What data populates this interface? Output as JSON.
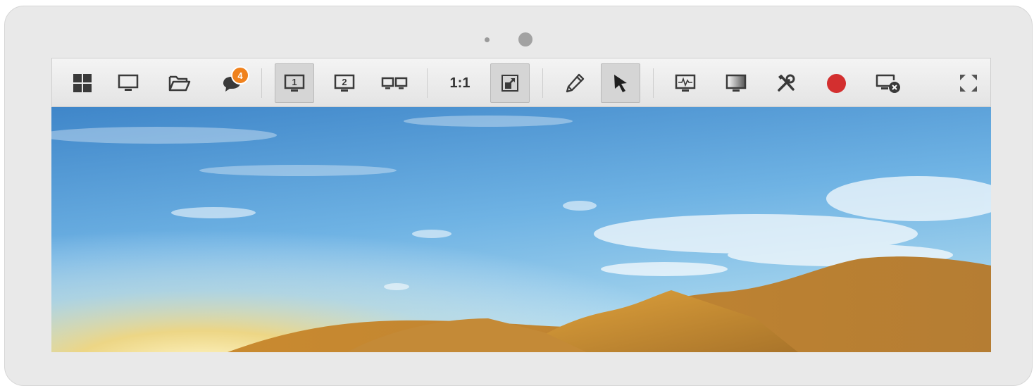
{
  "toolbar": {
    "chat_badge_count": "4",
    "scale_label": "1:1",
    "monitor1_label": "1",
    "monitor2_label": "2",
    "record_color": "#d32f2f",
    "badge_color": "#f0821d"
  },
  "icons": [
    "grid-icon",
    "monitor-icon",
    "folder-icon",
    "chat-icon",
    "monitor-1-icon",
    "monitor-2-icon",
    "dual-monitor-icon",
    "scale-1-1",
    "fit-screen-icon",
    "pencil-icon",
    "cursor-icon",
    "system-info-icon",
    "display-quality-icon",
    "tools-icon",
    "record-icon",
    "disconnect-icon",
    "fullscreen-icon"
  ]
}
